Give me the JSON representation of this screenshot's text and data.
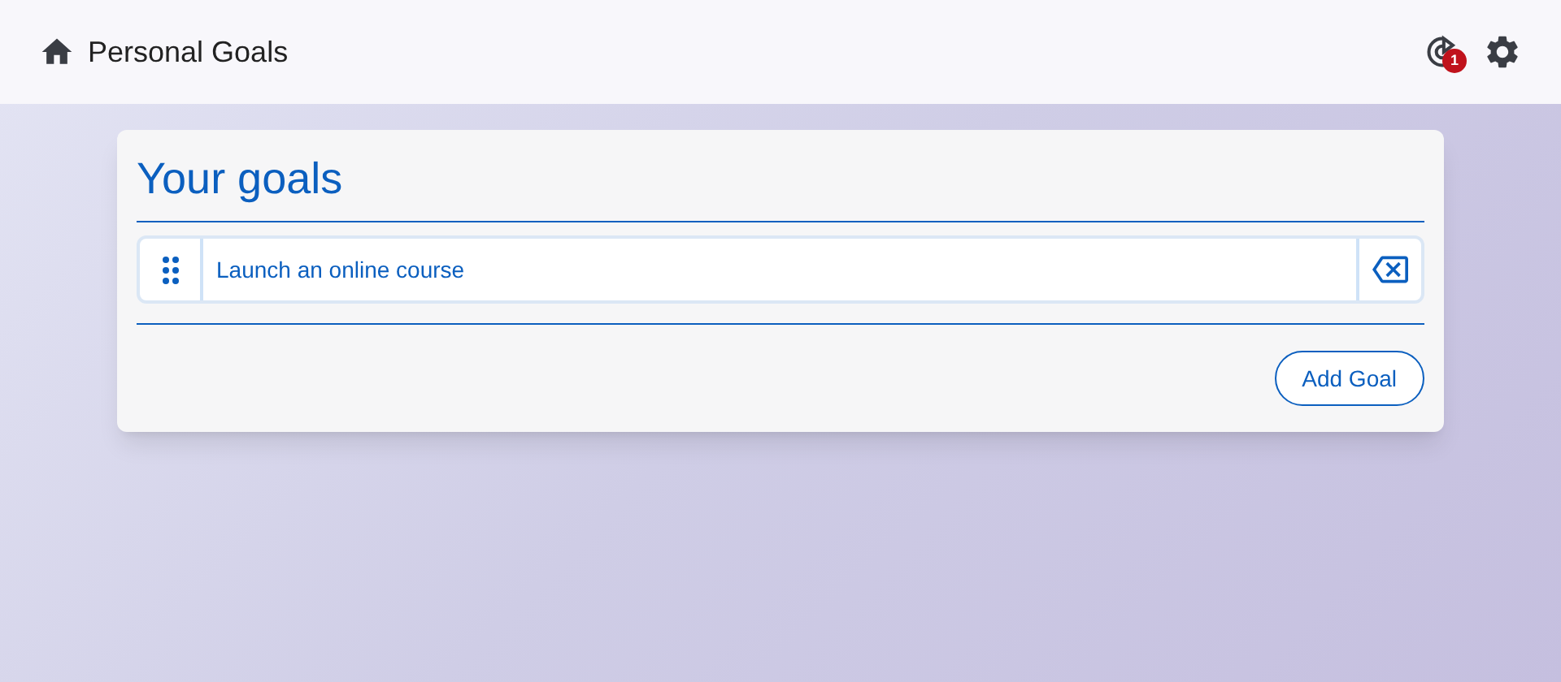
{
  "header": {
    "title": "Personal Goals",
    "notification_count": "1"
  },
  "card": {
    "title": "Your goals",
    "goals": [
      {
        "value": "Launch an online course"
      }
    ],
    "add_button": "Add Goal"
  }
}
